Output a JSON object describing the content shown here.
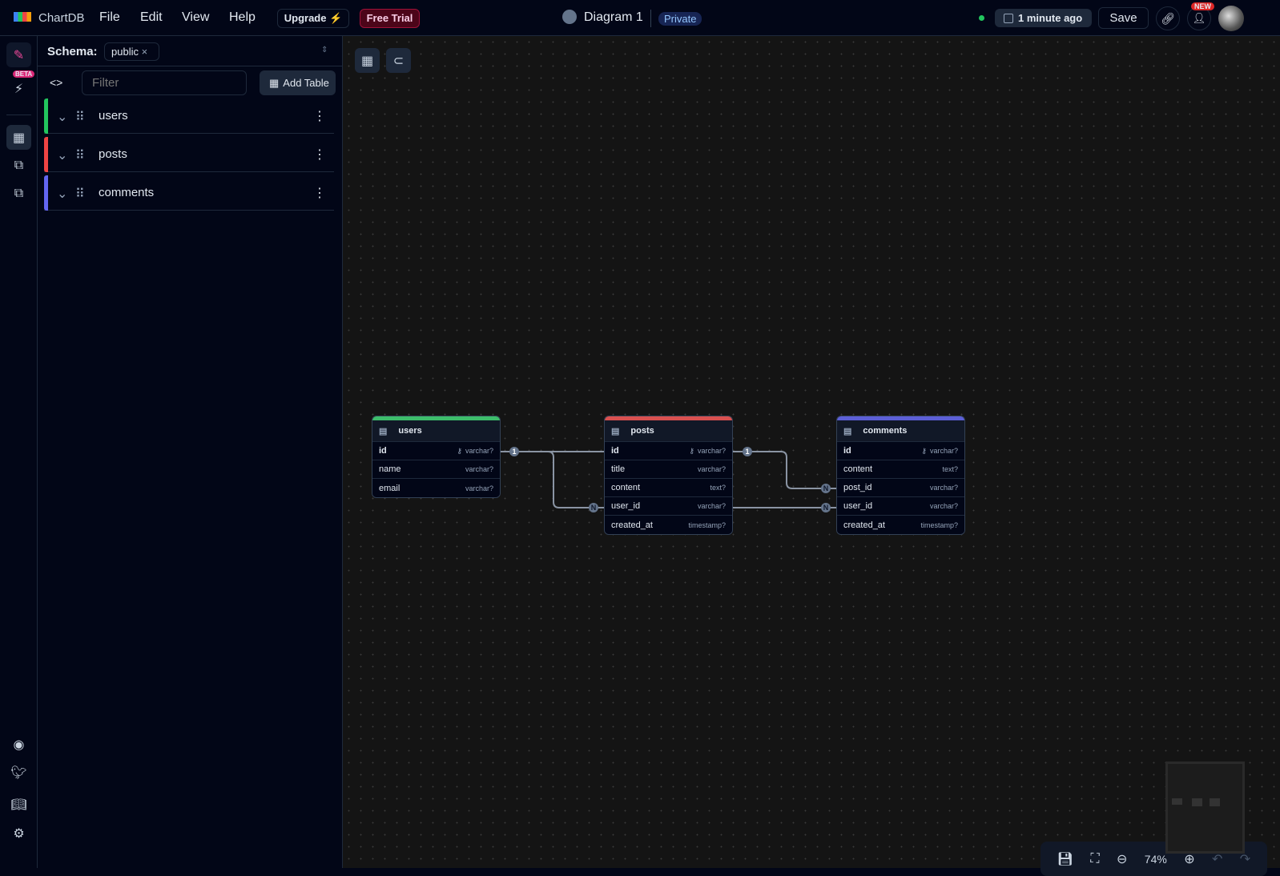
{
  "topbar": {
    "brand": "ChartDB",
    "menu": [
      "File",
      "Edit",
      "View",
      "Help"
    ],
    "upgrade": "Upgrade ⚡",
    "free_trial": "Free Trial",
    "diagram_name": "Diagram 1",
    "visibility": "Private",
    "saved": "1 minute ago",
    "save": "Save",
    "new_badge": "NEW"
  },
  "rail": {
    "beta": "BETA"
  },
  "sidebar": {
    "schema_label": "Schema:",
    "schema_value": "public",
    "filter_placeholder": "Filter",
    "add_table": "Add Table",
    "tables": [
      {
        "name": "users",
        "color": "#22c55e"
      },
      {
        "name": "posts",
        "color": "#ef4444"
      },
      {
        "name": "comments",
        "color": "#6366f1"
      }
    ]
  },
  "diagram": {
    "tables": [
      {
        "name": "users",
        "color": "#3dbd6b",
        "fields": [
          {
            "name": "id",
            "type": "varchar?",
            "pk": true
          },
          {
            "name": "name",
            "type": "varchar?"
          },
          {
            "name": "email",
            "type": "varchar?"
          }
        ]
      },
      {
        "name": "posts",
        "color": "#d9504f",
        "fields": [
          {
            "name": "id",
            "type": "varchar?",
            "pk": true
          },
          {
            "name": "title",
            "type": "varchar?"
          },
          {
            "name": "content",
            "type": "text?"
          },
          {
            "name": "user_id",
            "type": "varchar?"
          },
          {
            "name": "created_at",
            "type": "timestamp?"
          }
        ]
      },
      {
        "name": "comments",
        "color": "#5c5fd6",
        "fields": [
          {
            "name": "id",
            "type": "varchar?",
            "pk": true
          },
          {
            "name": "content",
            "type": "text?"
          },
          {
            "name": "post_id",
            "type": "varchar?"
          },
          {
            "name": "user_id",
            "type": "varchar?"
          },
          {
            "name": "created_at",
            "type": "timestamp?"
          }
        ]
      }
    ],
    "relations": [
      {
        "from": "users.id",
        "to": "posts.user_id",
        "from_card": "1",
        "to_card": "N"
      },
      {
        "from": "posts.id",
        "to": "comments.post_id",
        "from_card": "1",
        "to_card": "N"
      },
      {
        "from": "posts.user_id",
        "to": "comments.user_id",
        "from_card": "",
        "to_card": "N"
      }
    ]
  },
  "zoom": {
    "level": "74%"
  }
}
